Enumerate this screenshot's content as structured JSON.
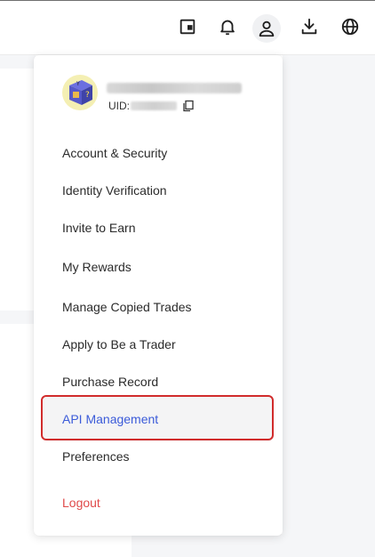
{
  "topbar": {
    "icons": [
      {
        "name": "wallet-icon"
      },
      {
        "name": "bell-icon"
      },
      {
        "name": "user-icon"
      },
      {
        "name": "download-icon"
      },
      {
        "name": "globe-icon"
      }
    ]
  },
  "profile": {
    "uid_label": "UID:",
    "name_obscured": true
  },
  "menu": {
    "items": [
      {
        "label": "Account & Security"
      },
      {
        "label": "Identity Verification"
      },
      {
        "label": "Invite to Earn"
      },
      {
        "label": "My Rewards"
      },
      {
        "label": "Manage Copied Trades"
      },
      {
        "label": "Apply to Be a Trader"
      },
      {
        "label": "Purchase Record"
      },
      {
        "label": "API Management"
      },
      {
        "label": "Preferences"
      },
      {
        "label": "Logout"
      }
    ]
  },
  "colors": {
    "highlight_text": "#3b5bd9",
    "logout_text": "#e04a4a",
    "highlight_border": "#d12c2c"
  }
}
